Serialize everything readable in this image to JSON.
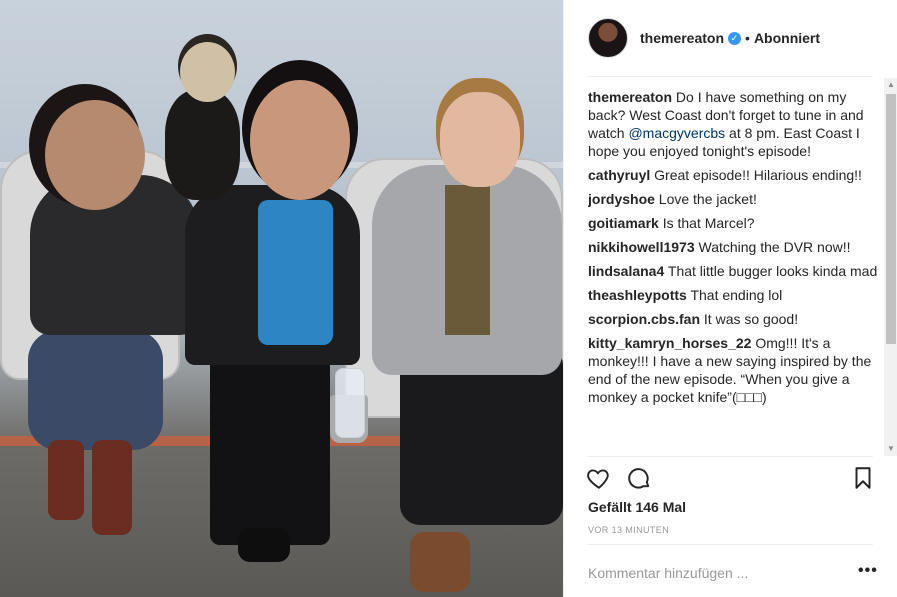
{
  "post": {
    "username": "themereaton",
    "verified_icon": "verified-badge-icon",
    "separator": "•",
    "follow_state": "Abonniert",
    "caption": {
      "user": "themereaton",
      "text_before": "Do I have something on my back? West Coast don't forget to tune in and watch",
      "mention": "@macgyvercbs",
      "text_after": "at 8 pm. East Coast I hope you enjoyed tonight's episode!"
    },
    "comments": [
      {
        "user": "cathyruyl",
        "text": "Great episode!! Hilarious ending!!"
      },
      {
        "user": "jordyshoe",
        "text": "Love the jacket!"
      },
      {
        "user": "goitiamark",
        "text": "Is that Marcel?"
      },
      {
        "user": "nikkihowell1973",
        "text": "Watching the DVR now!!"
      },
      {
        "user": "lindsalana4",
        "text": "That little bugger looks kinda mad"
      },
      {
        "user": "theashleypotts",
        "text": "That ending lol"
      },
      {
        "user": "scorpion.cbs.fan",
        "text": "It was so good!"
      },
      {
        "user": "kitty_kamryn_horses_22",
        "text": "Omg!!! It's a monkey!!! I have a new saying inspired by the end of the new episode. “When you give a monkey a pocket knife”(□□□)"
      }
    ],
    "likes": "Gefällt 146 Mal",
    "time_ago": "VOR 13 MINUTEN",
    "add_comment_placeholder": "Kommentar hinzufügen ...",
    "more_label": "•••"
  },
  "icons": {
    "like": "heart-icon",
    "comment": "comment-icon",
    "save": "bookmark-icon",
    "scroll_up": "scroll-up-arrow-icon",
    "scroll_down": "scroll-down-arrow-icon"
  },
  "scrollbar": {
    "up": "▲",
    "down": "▼"
  }
}
